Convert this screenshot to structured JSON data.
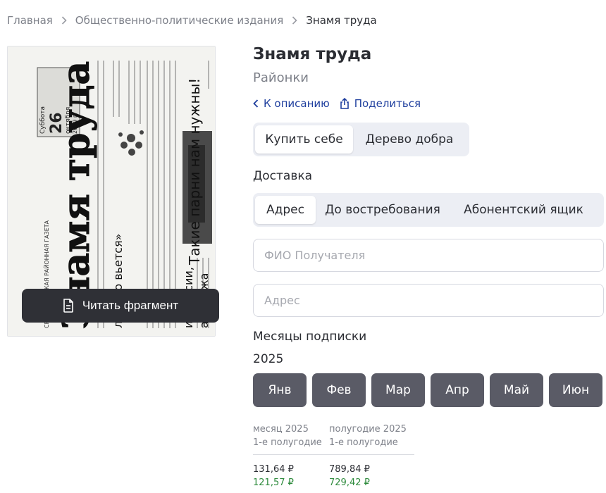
{
  "breadcrumb": {
    "items": [
      "Главная",
      "Общественно-политические издания"
    ],
    "current": "Знамя труда"
  },
  "cover": {
    "masthead": "Знамя труда",
    "region_line": "СРЕБРИХИНСКАЯ РАЙОННАЯ ГАЗЕТА",
    "weekday": "Суббота",
    "day": "26",
    "month": "октября",
    "year": "2019 г.",
    "headline_1": "Такие парни нам нужны!",
    "headline_2": "лентою вьется»",
    "headline_3": "из России,",
    "headline_4": "а рубежа",
    "read_label": "Читать фрагмент"
  },
  "product": {
    "title": "Знамя труда",
    "subtitle": "Районки"
  },
  "links": {
    "back": "К описанию",
    "share": "Поделиться"
  },
  "purchase_tabs": {
    "buy_self": "Купить себе",
    "tree_of_good": "Дерево добра"
  },
  "delivery": {
    "label": "Доставка",
    "address": "Адрес",
    "on_demand": "До востребования",
    "po_box": "Абонентский ящик"
  },
  "form": {
    "recipient_placeholder": "ФИО Получателя",
    "address_placeholder": "Адрес"
  },
  "subscription": {
    "label": "Месяцы подписки",
    "year": "2025",
    "months": [
      "Янв",
      "Фев",
      "Мар",
      "Апр",
      "Май",
      "Июн"
    ]
  },
  "prices": {
    "month_head_1": "месяц 2025",
    "month_head_2": "1-е полугодие",
    "half_head_1": "полугодие 2025",
    "half_head_2": "1-е полугодие",
    "month_old": "131,64 ₽",
    "month_new": "121,57 ₽",
    "half_old": "789,84 ₽",
    "half_new": "729,42 ₽"
  },
  "colors": {
    "accent_link": "#1f3f9e",
    "dark_button": "#2f3036",
    "month_button": "#5a5b66",
    "discount_price": "#2e8b3d",
    "segment_bg": "#eceef4"
  }
}
